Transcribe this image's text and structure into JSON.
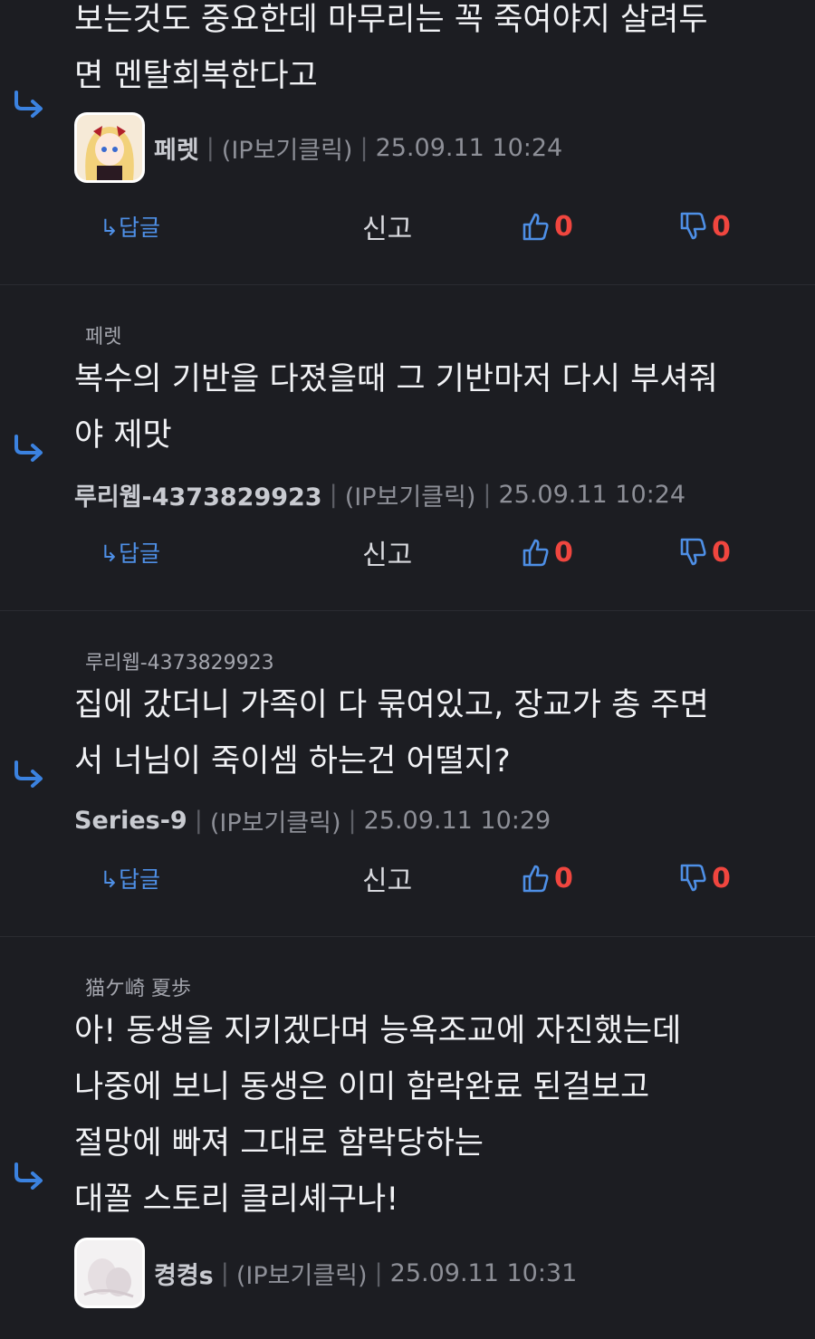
{
  "colors": {
    "background": "#1c1d22",
    "accent_blue": "#3b82e0",
    "count_red": "#f0463f"
  },
  "common": {
    "reply_label": "↳답글",
    "report_label": "신고",
    "ip_label": "(IP보기클릭)",
    "separator": "|"
  },
  "comments": [
    {
      "reply_to": "",
      "body": "보는것도 중요한데 마무리는 꼭 죽여야지 살려두\n면 멘탈회복한다고",
      "nick": "페렛",
      "timestamp": "25.09.11 10:24",
      "likes": "0",
      "dislikes": "0",
      "avatar_icon": "anime-girl-avatar-icon"
    },
    {
      "reply_to": "페렛",
      "body": "복수의 기반을 다졌을때 그 기반마저 다시 부셔줘\n야 제맛",
      "nick": "루리웹-4373829923",
      "timestamp": "25.09.11 10:24",
      "likes": "0",
      "dislikes": "0"
    },
    {
      "reply_to": "루리웹-4373829923",
      "body": "집에 갔더니 가족이 다 묶여있고, 장교가 총 주면\n서 너님이 죽이셈 하는건 어떨지?",
      "nick": "Series-9",
      "timestamp": "25.09.11 10:29",
      "likes": "0",
      "dislikes": "0"
    },
    {
      "reply_to": "猫ケ崎 夏歩",
      "body": "아! 동생을 지키겠다며 능욕조교에 자진했는데\n나중에 보니 동생은 이미 함락완료 된걸보고\n절망에 빠져 그대로 함락당하는\n대꼴 스토리 클리셰구나!",
      "nick": "켱켱s",
      "timestamp": "25.09.11 10:31",
      "avatar_icon": "white-figure-avatar-icon"
    }
  ]
}
